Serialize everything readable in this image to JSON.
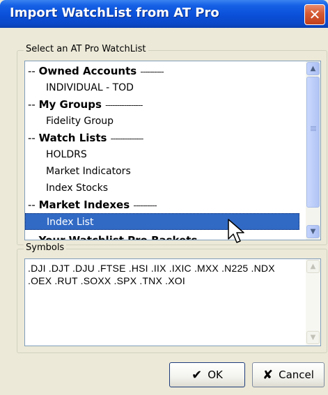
{
  "window": {
    "title": "Import WatchList from AT Pro",
    "close_glyph": "✕"
  },
  "watchlist_group": {
    "label": "Select an AT Pro WatchList",
    "items": [
      {
        "kind": "header",
        "dash": "-- ",
        "label": "Owned Accounts",
        "trail": "----------"
      },
      {
        "kind": "item",
        "label": "INDIVIDUAL - TOD"
      },
      {
        "kind": "header",
        "dash": "-- ",
        "label": "My Groups",
        "trail": "----------------"
      },
      {
        "kind": "item",
        "label": "Fidelity Group"
      },
      {
        "kind": "header",
        "dash": "-- ",
        "label": "Watch Lists",
        "trail": "--------------"
      },
      {
        "kind": "item",
        "label": "HOLDRS"
      },
      {
        "kind": "item",
        "label": "Market Indicators"
      },
      {
        "kind": "item",
        "label": "Index Stocks"
      },
      {
        "kind": "header",
        "dash": "-- ",
        "label": "Market Indexes",
        "trail": "----------"
      },
      {
        "kind": "item",
        "label": "Index List",
        "selected": true
      },
      {
        "kind": "header",
        "dash": "-- ",
        "label": "Your Watchlist Pro Baskets",
        "trail": "",
        "partial": true
      }
    ],
    "scroll_up_icon": "▲",
    "scroll_down_icon": "▼"
  },
  "symbols_group": {
    "label": "Symbols",
    "text": ".DJI .DJT .DJU .FTSE .HSI .IIX .IXIC .MXX .N225 .NDX .OEX .RUT .SOXX .SPX .TNX .XOI",
    "scroll_up_icon": "▲",
    "scroll_down_icon": "▼"
  },
  "buttons": {
    "ok": {
      "icon": "✔",
      "label": "OK"
    },
    "cancel": {
      "icon": "✘",
      "label": "Cancel"
    }
  },
  "colors": {
    "titlebar": "#0a4fd8",
    "selection": "#316ac5",
    "dialog_bg": "#ece9d8"
  }
}
